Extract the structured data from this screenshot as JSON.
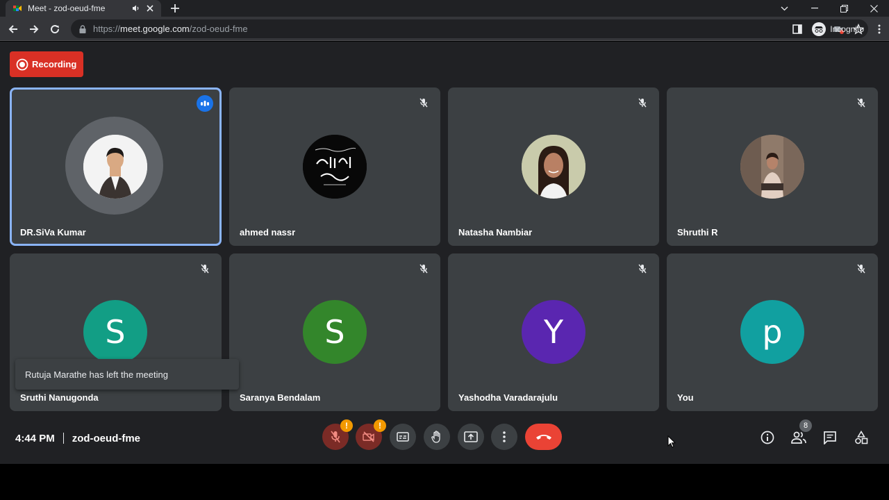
{
  "browser": {
    "tab_title": "Meet - zod-oeud-fme",
    "url_scheme": "https://",
    "url_host": "meet.google.com",
    "url_path": "/zod-oeud-fme",
    "profile_label": "Incognito"
  },
  "recording": {
    "label": "Recording",
    "color": "#d93025"
  },
  "participants": [
    {
      "name": "DR.SiVa Kumar",
      "avatar": "photo",
      "speaking": true,
      "muted": false
    },
    {
      "name": "ahmed nassr",
      "avatar": "photo",
      "speaking": false,
      "muted": true
    },
    {
      "name": "Natasha Nambiar",
      "avatar": "photo",
      "speaking": false,
      "muted": true
    },
    {
      "name": "Shruthi R",
      "avatar": "photo",
      "speaking": false,
      "muted": true
    },
    {
      "name": "Sruthi Nanugonda",
      "avatar_letter": "S",
      "avatar_color": "#129e85",
      "muted": true
    },
    {
      "name": "Saranya Bendalam",
      "avatar_letter": "S",
      "avatar_color": "#33862b",
      "muted": true
    },
    {
      "name": "Yashodha Varadarajulu",
      "avatar_letter": "Y",
      "avatar_color": "#5a26b0",
      "muted": true
    },
    {
      "name": "You",
      "avatar_letter": "p",
      "avatar_color": "#11a0a0",
      "muted": true
    }
  ],
  "toast": {
    "message": "Rutuja Marathe has left the meeting"
  },
  "meeting": {
    "time": "4:44 PM",
    "code": "zod-oeud-fme"
  },
  "controls": {
    "mic_warning_badge": "!",
    "camera_warning_badge": "!"
  },
  "people_count": "8",
  "colors": {
    "accent": "#8ab4f8",
    "end_call": "#ea4335",
    "warning": "#f29900",
    "tile": "#3c4043",
    "background": "#202124"
  }
}
